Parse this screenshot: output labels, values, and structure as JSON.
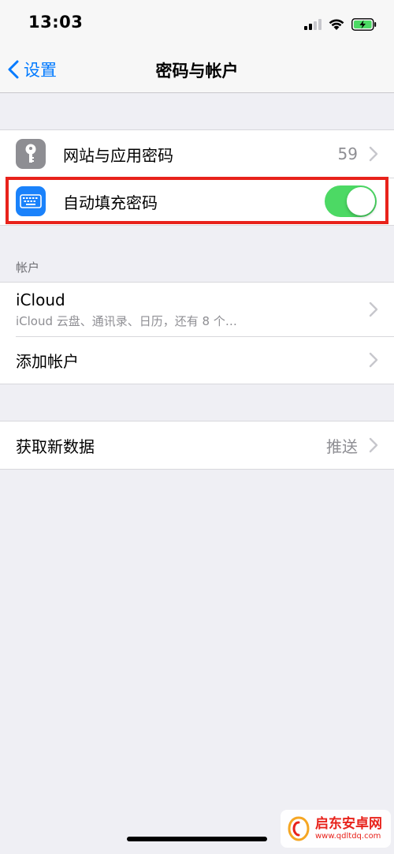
{
  "status_bar": {
    "time": "13:03"
  },
  "nav": {
    "back_label": "设置",
    "title": "密码与帐户"
  },
  "passwords_group": {
    "website_passwords": {
      "label": "网站与应用密码",
      "value": "59"
    },
    "autofill": {
      "label": "自动填充密码",
      "enabled": true
    }
  },
  "accounts_section": {
    "header": "帐户",
    "icloud": {
      "label": "iCloud",
      "detail": "iCloud 云盘、通讯录、日历，还有 8 个…"
    },
    "add_account": {
      "label": "添加帐户"
    }
  },
  "fetch_group": {
    "fetch_new_data": {
      "label": "获取新数据",
      "value": "推送"
    }
  },
  "watermark": {
    "title": "启东安卓网",
    "url": "www.qdltdq.com"
  },
  "colors": {
    "accent": "#007aff",
    "toggle_on": "#4cd964",
    "highlight": "#e8221b",
    "key_icon_bg": "#8e8e93",
    "keyboard_icon_bg": "#1a82fb"
  }
}
